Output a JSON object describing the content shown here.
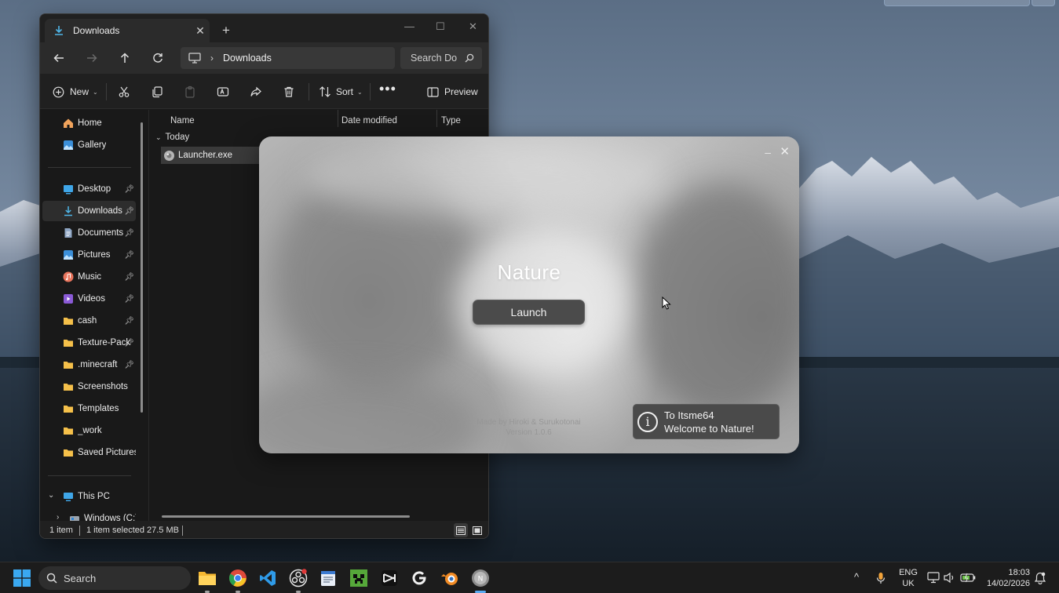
{
  "explorer": {
    "tab_title": "Downloads",
    "address_path": "Downloads",
    "search_placeholder": "Search Do",
    "toolbar": {
      "new_label": "New",
      "sort_label": "Sort",
      "preview_label": "Preview"
    },
    "sidebar": {
      "items": [
        {
          "label": "Home",
          "icon": "home-icon"
        },
        {
          "label": "Gallery",
          "icon": "gallery-icon"
        },
        {
          "label": "Desktop",
          "icon": "desktop-icon",
          "pinned": true
        },
        {
          "label": "Downloads",
          "icon": "download-icon",
          "pinned": true,
          "active": true
        },
        {
          "label": "Documents",
          "icon": "documents-icon",
          "pinned": true
        },
        {
          "label": "Pictures",
          "icon": "pictures-icon",
          "pinned": true
        },
        {
          "label": "Music",
          "icon": "music-icon",
          "pinned": true
        },
        {
          "label": "Videos",
          "icon": "videos-icon",
          "pinned": true
        },
        {
          "label": "cash",
          "icon": "folder-icon",
          "pinned": true
        },
        {
          "label": "Texture-Pack",
          "icon": "folder-icon",
          "pinned": true
        },
        {
          "label": ".minecraft",
          "icon": "folder-icon",
          "pinned": true
        },
        {
          "label": "Screenshots",
          "icon": "folder-icon"
        },
        {
          "label": "Templates",
          "icon": "folder-icon"
        },
        {
          "label": "_work",
          "icon": "folder-icon"
        },
        {
          "label": "Saved Pictures",
          "icon": "folder-icon"
        }
      ],
      "this_pc": "This PC",
      "drive": "Windows (C:)"
    },
    "columns": {
      "name": "Name",
      "date": "Date modified",
      "type": "Type"
    },
    "group_label": "Today",
    "file_name": "Launcher.exe",
    "status": {
      "count": "1 item",
      "selected": "1 item selected",
      "size": "27.5 MB"
    }
  },
  "launcher": {
    "title": "Nature",
    "launch_label": "Launch",
    "credit_line1": "Made by Hiroki & Surukotonai",
    "credit_line2": "Version 1.0.6",
    "toast_line1": "To Itsme64",
    "toast_line2": "Welcome to Nature!"
  },
  "taskbar": {
    "search_label": "Search",
    "apps": [
      "file-explorer-icon",
      "chrome-icon",
      "vscode-icon",
      "obs-icon",
      "notepad-icon",
      "minecraft-icon",
      "capcut-icon",
      "ghub-icon",
      "blender-icon",
      "nature-launcher-icon"
    ],
    "lang_line1": "ENG",
    "lang_line2": "UK",
    "time": "18:03",
    "date": "14/02/2026"
  },
  "colors": {
    "explorer_bg": "#191919",
    "launcher_button": "#4b4b4b",
    "taskbar_bg": "#1c1c1c"
  }
}
